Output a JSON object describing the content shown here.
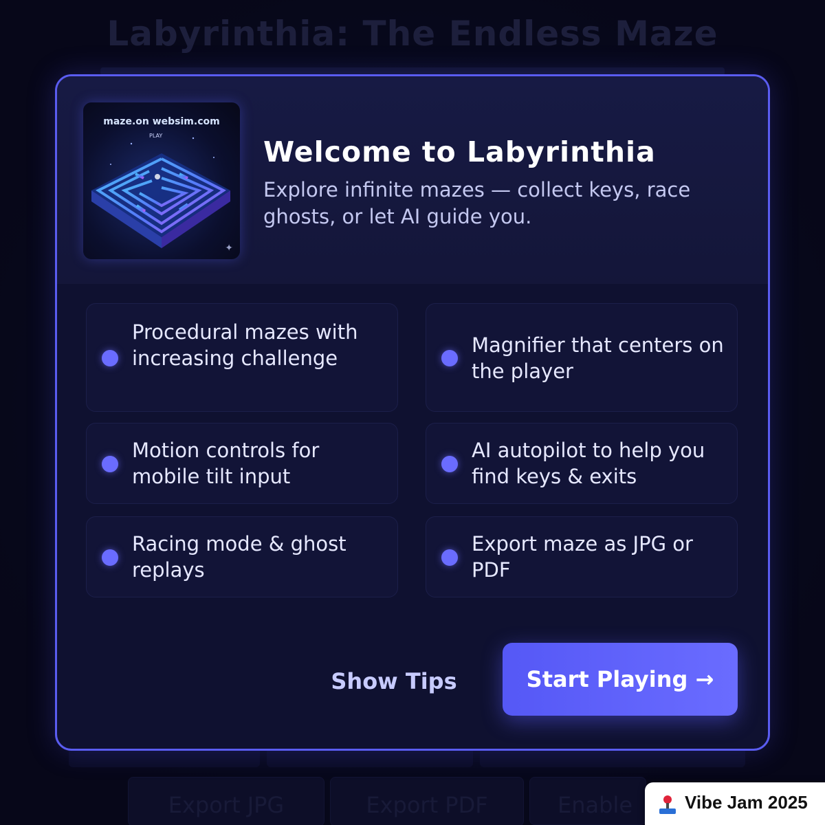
{
  "background": {
    "title": "Labyrinthia: The Endless Maze",
    "buttons": [
      "Export JPG",
      "Export PDF",
      "Enable"
    ]
  },
  "modal": {
    "thumbnail": {
      "caption": "maze.on websim.com",
      "play_label": "PLAY"
    },
    "title": "Welcome to Labyrinthia",
    "subtitle": "Explore infinite mazes — collect keys, race ghosts, or let AI guide you.",
    "features": [
      {
        "text": "Procedural mazes with increasing challenge"
      },
      {
        "text": "Magnifier that centers on the player"
      },
      {
        "text": "Motion controls for mobile tilt input"
      },
      {
        "text": "AI autopilot to help you find keys & exits"
      },
      {
        "text": "Racing mode & ghost replays"
      },
      {
        "text": "Export maze as JPG or PDF"
      }
    ],
    "secondary_button": "Show Tips",
    "primary_button": "Start Playing →"
  },
  "badge": {
    "label": "Vibe Jam 2025"
  },
  "colors": {
    "accent": "#5a5cf0",
    "dot": "#6a6cff",
    "modal_bg": "#0f1130"
  }
}
